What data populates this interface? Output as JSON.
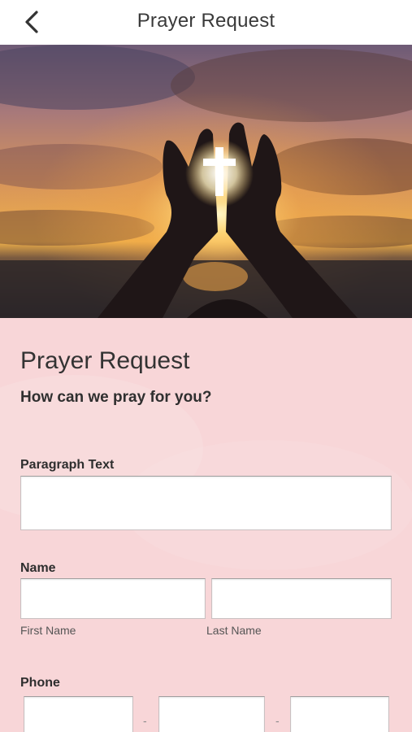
{
  "header": {
    "title": "Prayer Request",
    "back_icon": "chevron-left-icon"
  },
  "hero": {
    "image": "hands-holding-cross-sunset"
  },
  "form": {
    "title": "Prayer Request",
    "subtitle": "How can we pray for you?",
    "paragraph": {
      "label": "Paragraph Text",
      "value": ""
    },
    "name": {
      "label": "Name",
      "first_label": "First Name",
      "last_label": "Last Name",
      "first_value": "",
      "last_value": ""
    },
    "phone": {
      "label": "Phone",
      "separator": "-",
      "part1": "",
      "part2": "",
      "part3": ""
    }
  },
  "colors": {
    "form_background": "#f8d6d8",
    "text": "#333333"
  }
}
